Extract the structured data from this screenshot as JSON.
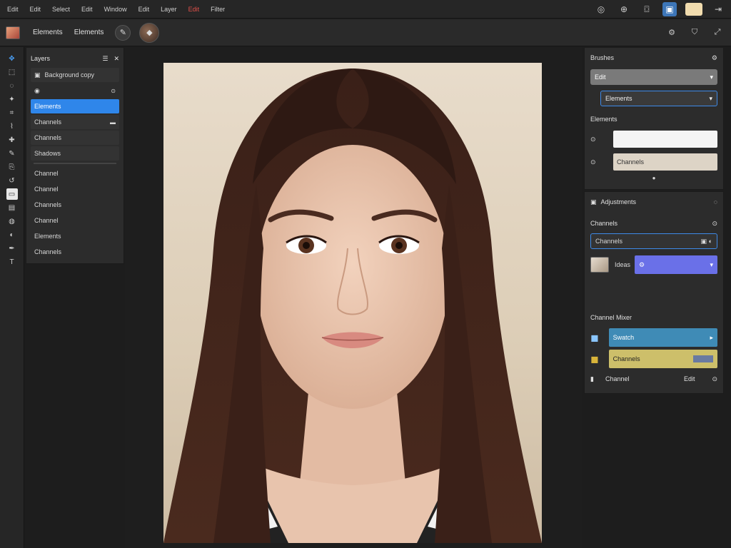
{
  "menu": [
    "Edit",
    "Edit",
    "Select",
    "Edit",
    "Window",
    "Edit",
    "Layer",
    "Edit",
    "Filter"
  ],
  "optbar": {
    "tool_name": "Elements",
    "tool_label": "Elements"
  },
  "layers": {
    "header_title": "Layers",
    "rows": [
      {
        "label": "Background copy",
        "kind": "plain"
      },
      {
        "label": "",
        "kind": "plain"
      },
      {
        "label": "Elements",
        "kind": "sel"
      },
      {
        "label": "Channels",
        "kind": "row"
      },
      {
        "label": "Channels",
        "kind": "row"
      },
      {
        "label": "Shadows",
        "kind": "row"
      },
      {
        "label": "Channel",
        "kind": "row"
      },
      {
        "label": "Channel",
        "kind": "row"
      },
      {
        "label": "Channels",
        "kind": "row"
      },
      {
        "label": "Channel",
        "kind": "row"
      },
      {
        "label": "Elements",
        "kind": "row"
      },
      {
        "label": "Channels",
        "kind": "row"
      }
    ]
  },
  "right_top": {
    "title": "Brushes",
    "dd1": "Edit",
    "dd2": "Elements",
    "sub_title": "Elements",
    "field2_value": "Channels"
  },
  "right_bottom": {
    "title": "Adjustments",
    "section1": "Channels",
    "section1_row": "Channels",
    "adj_label": "Ideas",
    "section2": "Channel Mixer",
    "teal_label": "Swatch",
    "gold_label": "Channels",
    "footer_left": "Channel",
    "footer_right": "Edit"
  },
  "colors": {
    "accent": "#2f86ea",
    "topswatch": "#f1dcae"
  }
}
